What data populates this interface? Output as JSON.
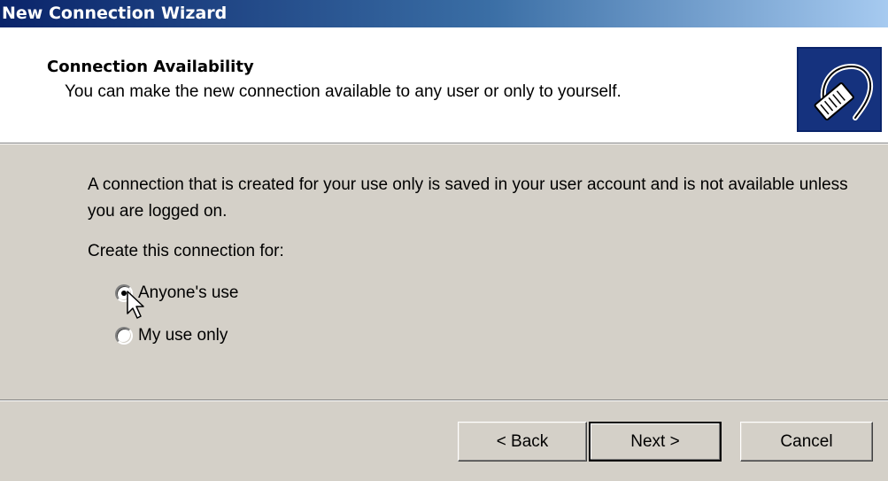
{
  "window": {
    "title": "New Connection Wizard"
  },
  "header": {
    "title": "Connection Availability",
    "subtitle": "You can make the new connection available to any user or only to yourself.",
    "icon": "network-cable-icon"
  },
  "content": {
    "description": "A connection that is created for your use only is saved in your user account and is not available unless you are logged on.",
    "group_label": "Create this connection for:",
    "options": [
      {
        "label": "Anyone's use",
        "selected": true
      },
      {
        "label": "My use only",
        "selected": false
      }
    ]
  },
  "buttons": {
    "back": "< Back",
    "next": "Next >",
    "cancel": "Cancel"
  },
  "colors": {
    "titlebar_start": "#0a246a",
    "titlebar_end": "#a6caf0",
    "dialog_bg": "#d4d0c8",
    "icon_bg": "#0a246a"
  }
}
